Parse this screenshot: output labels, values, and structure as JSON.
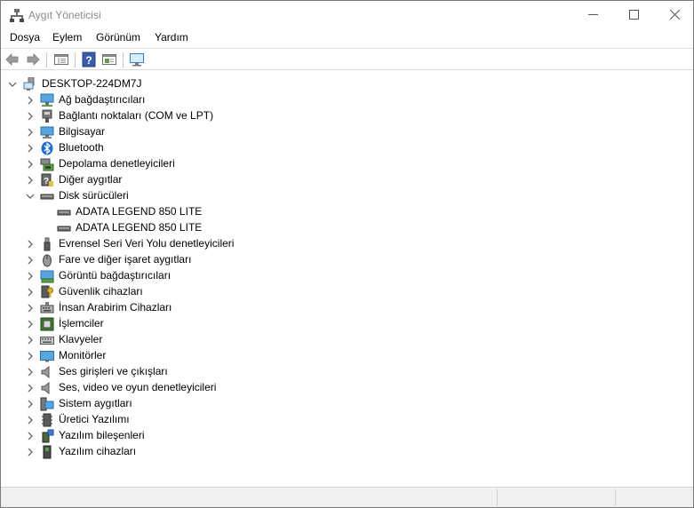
{
  "window": {
    "title": "Aygıt Yöneticisi"
  },
  "menu": {
    "items": [
      "Dosya",
      "Eylem",
      "Görünüm",
      "Yardım"
    ]
  },
  "toolbar": {
    "buttons": [
      "back-icon",
      "forward-icon",
      "properties-view-icon",
      "help-icon",
      "action-view-icon",
      "monitor-scan-icon"
    ]
  },
  "tree": {
    "root": "DESKTOP-224DM7J",
    "categories": [
      "Ağ bağdaştırıcıları",
      "Bağlantı noktaları (COM ve LPT)",
      "Bilgisayar",
      "Bluetooth",
      "Depolama denetleyicileri",
      "Diğer aygıtlar",
      "Disk sürücüleri",
      "Evrensel Seri Veri Yolu denetleyicileri",
      "Fare ve diğer işaret aygıtları",
      "Görüntü bağdaştırıcıları",
      "Güvenlik cihazları",
      "İnsan Arabirim Cihazları",
      "İşlemciler",
      "Klavyeler",
      "Monitörler",
      "Ses girişleri ve çıkışları",
      "Ses, video ve oyun denetleyicileri",
      "Sistem aygıtları",
      "Üretici Yazılımı",
      "Yazılım bileşenleri",
      "Yazılım cihazları"
    ],
    "disk_drives": [
      "ADATA LEGEND 850 LITE",
      "ADATA LEGEND 850 LITE"
    ],
    "expanded_category": "Disk sürücüleri"
  },
  "colors": {
    "title_inactive": "#8a8a8a",
    "icon_blue": "#1e88e5"
  }
}
